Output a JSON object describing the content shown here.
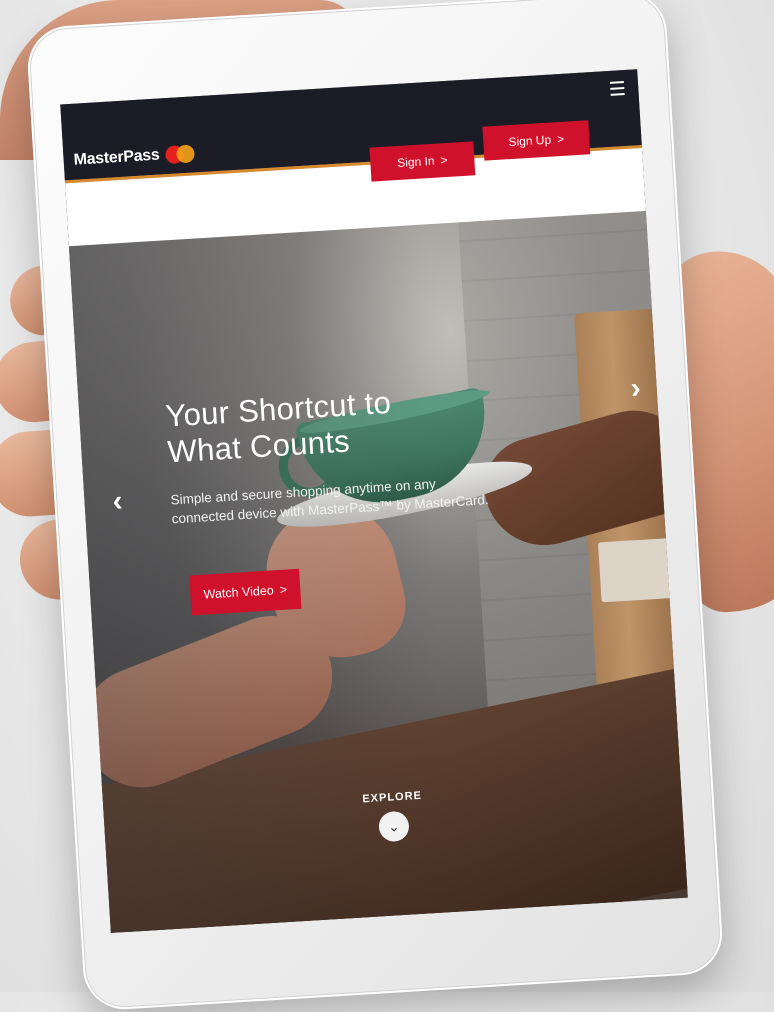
{
  "header": {
    "logo_text": "MasterPass",
    "menu_icon": "hamburger-menu-icon",
    "sign_in_label": "Sign In",
    "sign_up_label": "Sign Up",
    "button_chevron": ">"
  },
  "hero": {
    "title_line1": "Your Shortcut to",
    "title_line2": "What Counts",
    "subtitle": "Simple and secure shopping anytime on any connected device with MasterPass™ by MasterCard.",
    "watch_video_label": "Watch Video",
    "prev_arrow": "‹",
    "next_arrow": "›"
  },
  "explore": {
    "label": "EXPLORE",
    "icon": "chevron-down-icon",
    "glyph": "⌄"
  },
  "colors": {
    "brand_red": "#d0112b",
    "header_dark": "#1c1c26",
    "accent_orange": "#d68a2b"
  }
}
